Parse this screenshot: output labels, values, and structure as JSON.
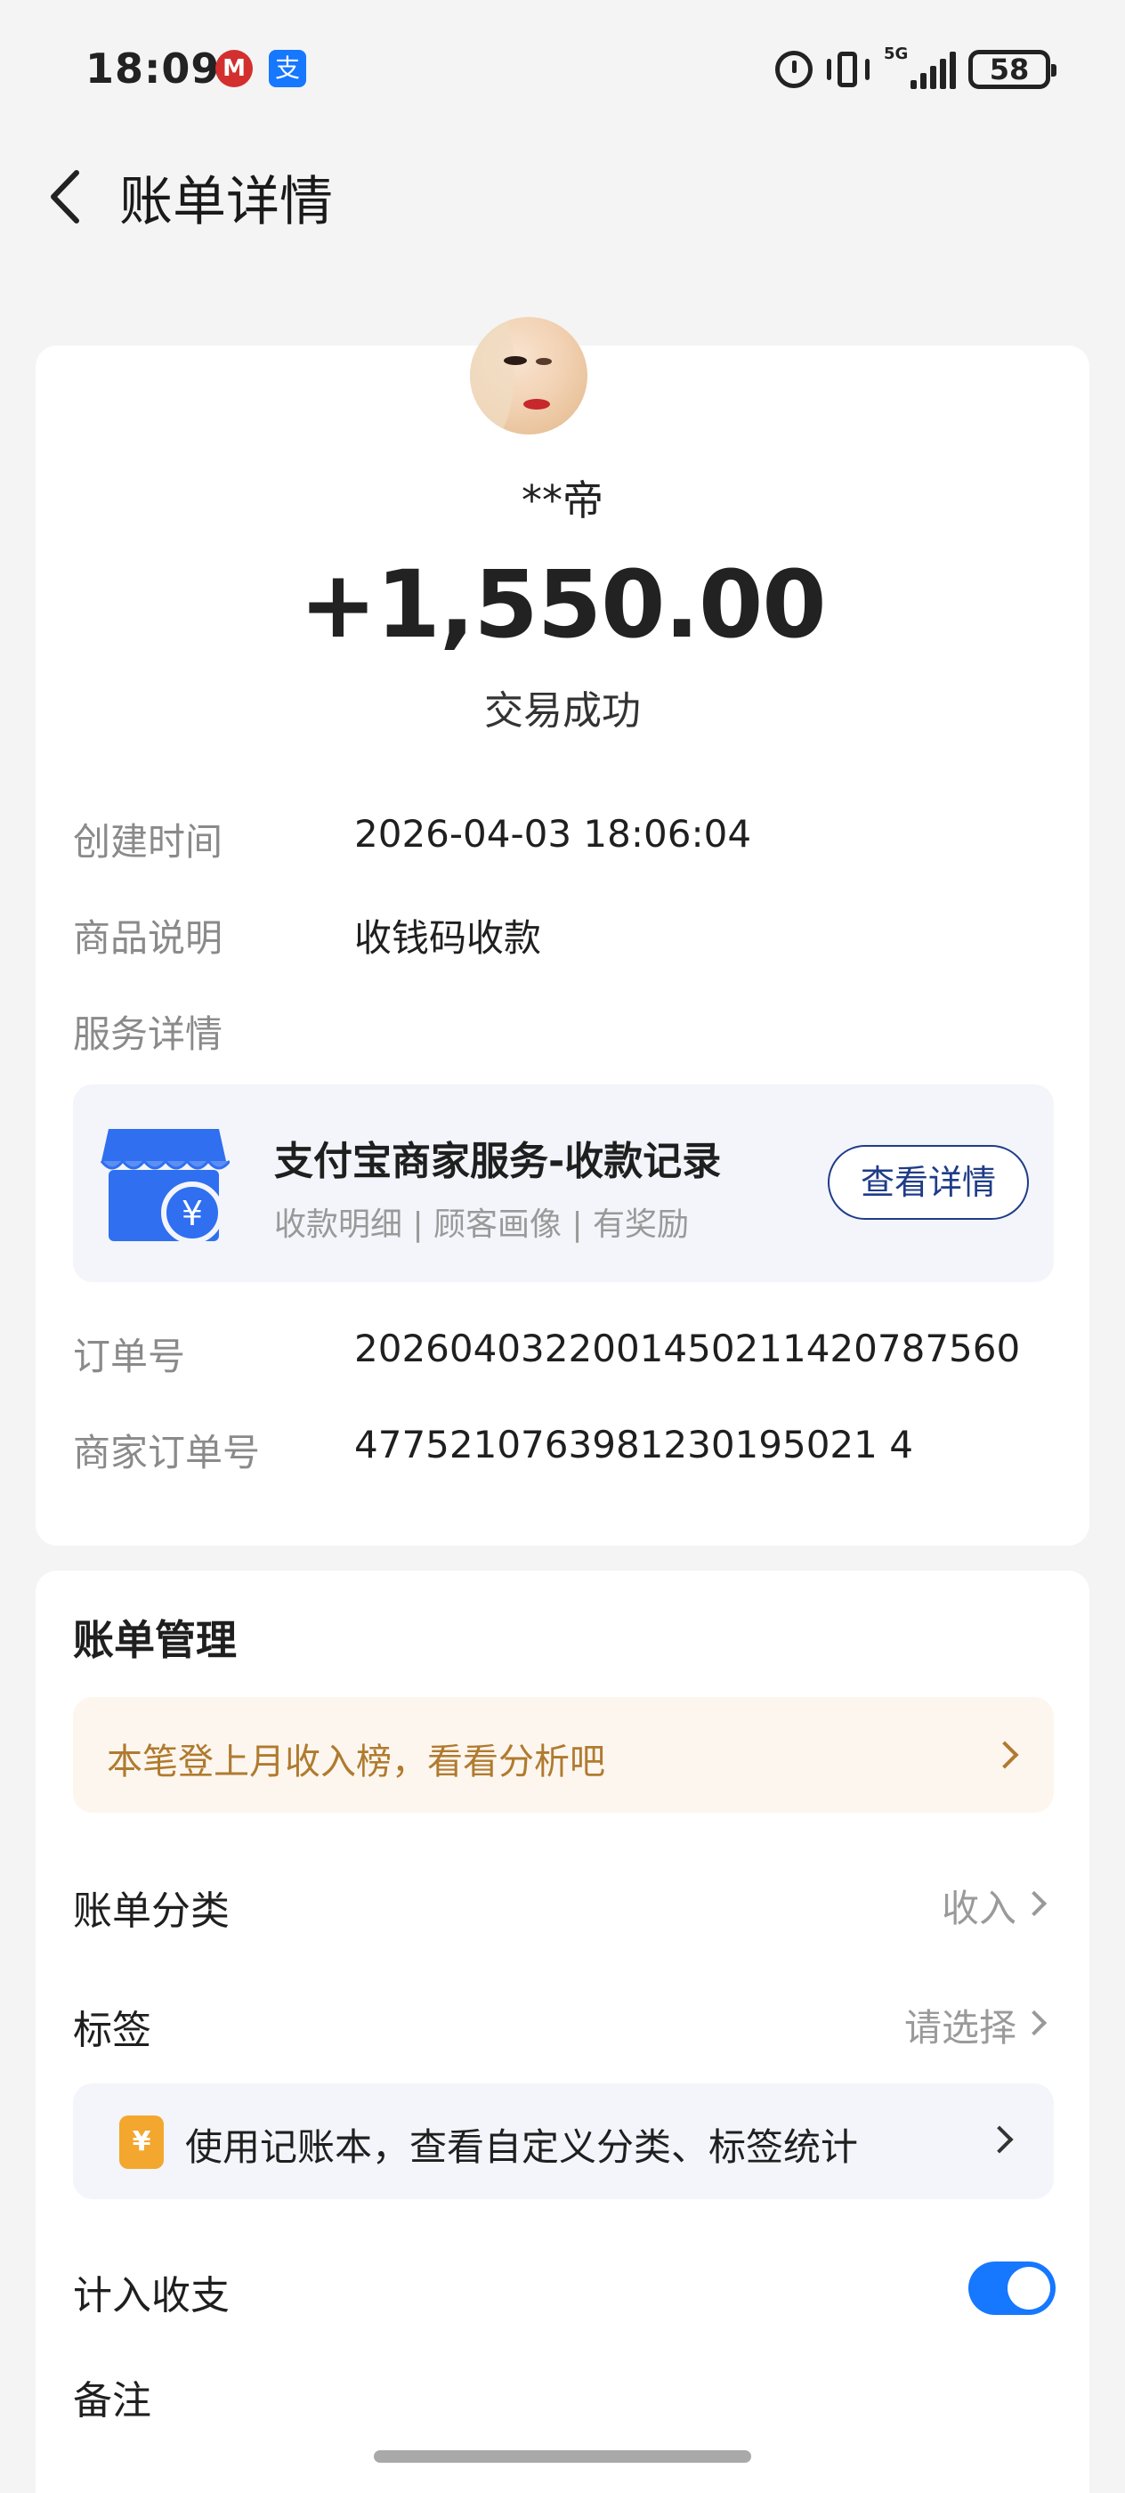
{
  "status_bar": {
    "time": "18:09",
    "metro_icon": "metro-logo-icon",
    "alipay_icon": "alipay-icon",
    "signal_label": "5G",
    "battery": "58"
  },
  "header": {
    "title": "账单详情",
    "back_icon": "chevron-left-icon"
  },
  "transaction": {
    "payer_name": "**帝",
    "amount": "+1,550.00",
    "status": "交易成功"
  },
  "details": {
    "created_label": "创建时间",
    "created_value": "2026-04-03 18:06:04",
    "goods_label": "商品说明",
    "goods_value": "收钱码收款",
    "service_label": "服务详情",
    "order_label": "订单号",
    "order_value": "2026040322001450211420787560",
    "merchant_order_label": "商家订单号",
    "merchant_order_value": "4775210763981230195021 4"
  },
  "service_card": {
    "title": "支付宝商家服务-收款记录",
    "subtitle": "收款明细 | 顾客画像 | 有奖励",
    "button": "查看详情",
    "currency_symbol": "¥"
  },
  "bill_management": {
    "title": "账单管理",
    "promo": "本笔登上月收入榜，看看分析吧",
    "category_label": "账单分类",
    "category_value": "收入",
    "tag_label": "标签",
    "tag_value": "请选择",
    "ledger_text": "使用记账本，查看自定义分类、标签统计",
    "ledger_icon_symbol": "¥",
    "include_label": "计入收支",
    "include_on": true,
    "remark_label": "备注"
  },
  "colors": {
    "accent": "#1677ff",
    "promo_text": "#b07b2f",
    "button_border": "#1f3c88"
  }
}
